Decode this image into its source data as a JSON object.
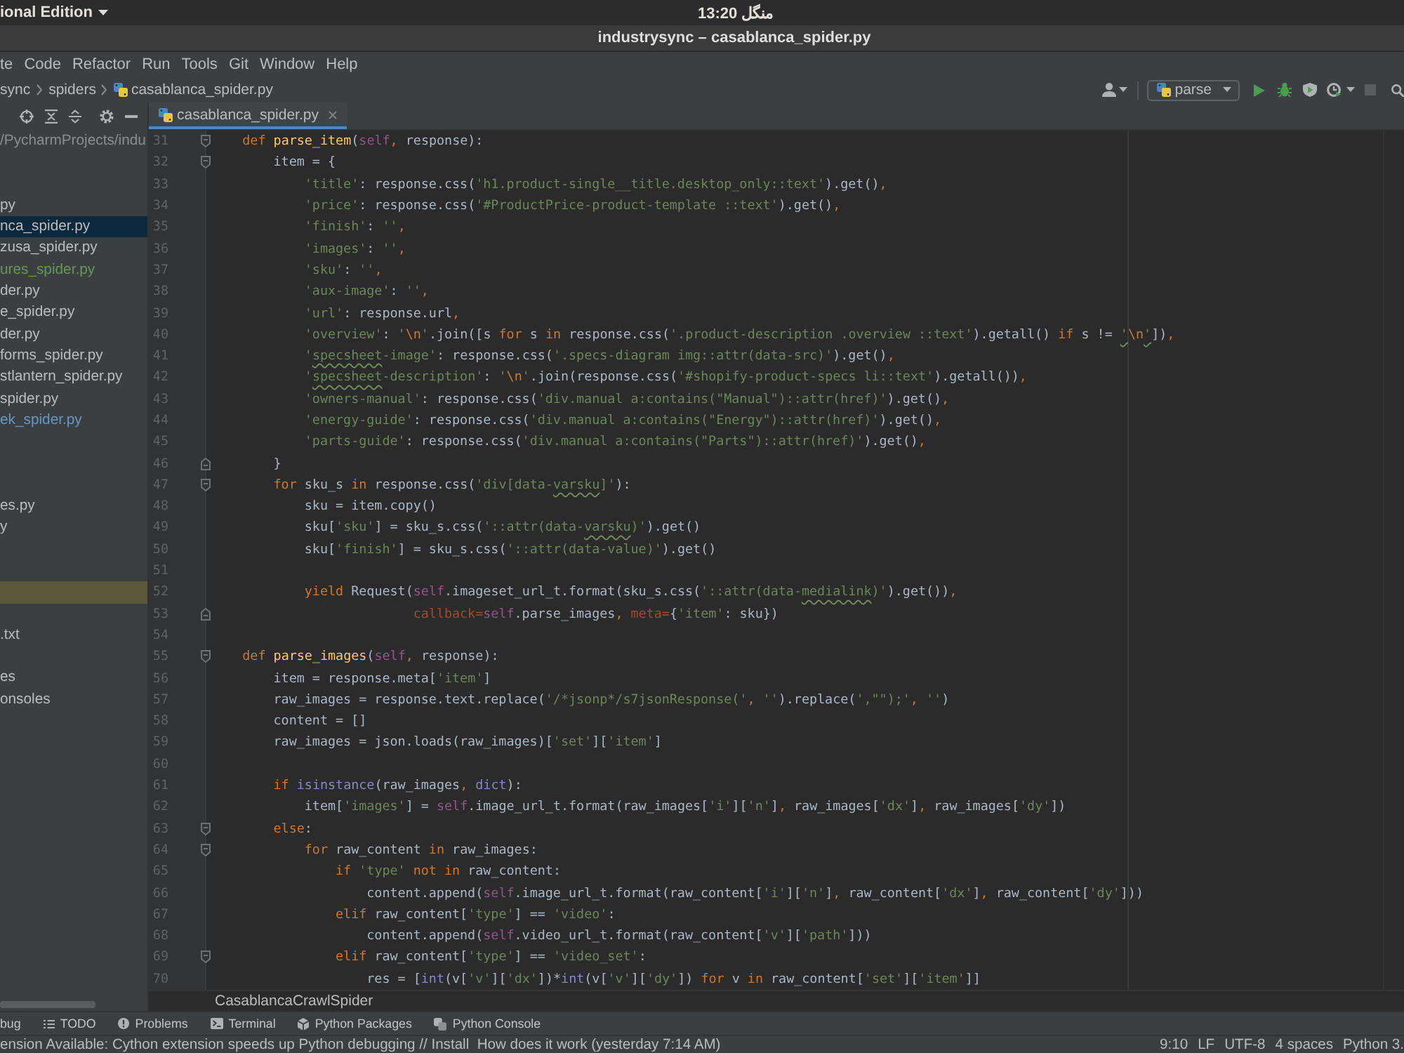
{
  "top_bar": {
    "app_menu": "ional Edition",
    "clock": "13:20 منگل"
  },
  "window": {
    "title": "industrysync – casablanca_spider.py"
  },
  "menu": [
    "te",
    "Code",
    "Refactor",
    "Run",
    "Tools",
    "Git",
    "Window",
    "Help"
  ],
  "navigation": {
    "path": [
      {
        "label": "sync",
        "kind": "folder"
      },
      {
        "label": "spiders",
        "kind": "folder"
      },
      {
        "label": "casablanca_spider.py",
        "kind": "file"
      }
    ],
    "run_config": "parse"
  },
  "project_tree": {
    "rows": [
      {
        "label": "/PycharmProjects/indu",
        "color": "#8c8c8c",
        "selected": false,
        "highlighted": false
      },
      {
        "selected": false,
        "highlighted": false
      },
      {
        "selected": false,
        "highlighted": false
      },
      {
        "label": "py",
        "color": "#bbbbbb",
        "selected": false,
        "highlighted": false
      },
      {
        "label": "nca_spider.py",
        "color": "#bbbbbb",
        "selected": true,
        "highlighted": false
      },
      {
        "label": "zusa_spider.py",
        "color": "#bbbbbb",
        "selected": false,
        "highlighted": false
      },
      {
        "label": "ures_spider.py",
        "color": "#629755",
        "selected": false,
        "highlighted": false
      },
      {
        "label": "der.py",
        "color": "#bbbbbb",
        "selected": false,
        "highlighted": false
      },
      {
        "label": "e_spider.py",
        "color": "#bbbbbb",
        "selected": false,
        "highlighted": false
      },
      {
        "label": "der.py",
        "color": "#bbbbbb",
        "selected": false,
        "highlighted": false
      },
      {
        "label": "forms_spider.py",
        "color": "#bbbbbb",
        "selected": false,
        "highlighted": false
      },
      {
        "label": "stlantern_spider.py",
        "color": "#bbbbbb",
        "selected": false,
        "highlighted": false
      },
      {
        "label": "spider.py",
        "color": "#bbbbbb",
        "selected": false,
        "highlighted": false
      },
      {
        "label": "ek_spider.py",
        "color": "#6897bb",
        "selected": false,
        "highlighted": false
      },
      {
        "selected": false,
        "highlighted": false
      },
      {
        "selected": false,
        "highlighted": false
      },
      {
        "selected": false,
        "highlighted": false
      },
      {
        "label": "es.py",
        "color": "#bbbbbb",
        "selected": false,
        "highlighted": false
      },
      {
        "label": "y",
        "color": "#bbbbbb",
        "selected": false,
        "highlighted": false
      },
      {
        "selected": false,
        "highlighted": false
      },
      {
        "selected": false,
        "highlighted": false
      },
      {
        "selected": false,
        "highlighted": true
      },
      {
        "selected": false,
        "highlighted": false
      },
      {
        "label": ".txt",
        "color": "#bbbbbb",
        "selected": false,
        "highlighted": false
      },
      {
        "selected": false,
        "highlighted": false
      },
      {
        "label": "es",
        "color": "#bbbbbb",
        "selected": false,
        "highlighted": false
      },
      {
        "label": "onsoles",
        "color": "#bbbbbb",
        "selected": false,
        "highlighted": false
      }
    ]
  },
  "tabs": [
    {
      "label": "casablanca_spider.py",
      "selected": true
    }
  ],
  "editor": {
    "lines": [
      {
        "number": "31",
        "kind": "opener",
        "tokens": [
          {
            "text": "    def ",
            "kind": "kw"
          },
          {
            "text": "parse_item",
            "kind": "fn"
          },
          {
            "text": "(",
            "kind": "plain"
          },
          {
            "text": "self",
            "kind": "self"
          },
          {
            "text": ",",
            "kind": "punct"
          },
          {
            "text": " response):",
            "kind": "plain"
          }
        ]
      },
      {
        "number": "32",
        "kind": "opener",
        "tokens": [
          {
            "text": "        item = {",
            "kind": "plain"
          }
        ]
      },
      {
        "number": "33",
        "kind": "line",
        "tokens": [
          {
            "text": "            'title'",
            "kind": "str"
          },
          {
            "text": ": response.css(",
            "kind": "plain"
          },
          {
            "text": "'h1.product-single__title.desktop_only::text'",
            "kind": "str"
          },
          {
            "text": ").get()",
            "kind": "plain"
          },
          {
            "text": ",",
            "kind": "punct"
          }
        ]
      },
      {
        "number": "34",
        "kind": "line",
        "tokens": [
          {
            "text": "            'price'",
            "kind": "str"
          },
          {
            "text": ": response.css(",
            "kind": "plain"
          },
          {
            "text": "'#ProductPrice-product-template ::text'",
            "kind": "str"
          },
          {
            "text": ").get()",
            "kind": "plain"
          },
          {
            "text": ",",
            "kind": "punct"
          }
        ]
      },
      {
        "number": "35",
        "kind": "line",
        "tokens": [
          {
            "text": "            'finish'",
            "kind": "str"
          },
          {
            "text": ": ",
            "kind": "plain"
          },
          {
            "text": "''",
            "kind": "str"
          },
          {
            "text": ",",
            "kind": "punct"
          }
        ]
      },
      {
        "number": "36",
        "kind": "line",
        "tokens": [
          {
            "text": "            'images'",
            "kind": "str"
          },
          {
            "text": ": ",
            "kind": "plain"
          },
          {
            "text": "''",
            "kind": "str"
          },
          {
            "text": ",",
            "kind": "punct"
          }
        ]
      },
      {
        "number": "37",
        "kind": "line",
        "tokens": [
          {
            "text": "            'sku'",
            "kind": "str"
          },
          {
            "text": ": ",
            "kind": "plain"
          },
          {
            "text": "''",
            "kind": "str"
          },
          {
            "text": ",",
            "kind": "punct"
          }
        ]
      },
      {
        "number": "38",
        "kind": "line",
        "tokens": [
          {
            "text": "            'aux-image'",
            "kind": "str"
          },
          {
            "text": ": ",
            "kind": "plain"
          },
          {
            "text": "''",
            "kind": "str"
          },
          {
            "text": ",",
            "kind": "punct"
          }
        ]
      },
      {
        "number": "39",
        "kind": "line",
        "tokens": [
          {
            "text": "            'url'",
            "kind": "str"
          },
          {
            "text": ": response.url",
            "kind": "plain"
          },
          {
            "text": ",",
            "kind": "punct"
          }
        ]
      },
      {
        "number": "40",
        "kind": "line",
        "tokens": [
          {
            "text": "            'overview'",
            "kind": "str"
          },
          {
            "text": ": ",
            "kind": "plain"
          },
          {
            "text": "'",
            "kind": "str"
          },
          {
            "text": "\\n",
            "kind": "esc"
          },
          {
            "text": "'",
            "kind": "str"
          },
          {
            "text": ".join([s ",
            "kind": "plain"
          },
          {
            "text": "for",
            "kind": "kw"
          },
          {
            "text": " s ",
            "kind": "plain"
          },
          {
            "text": "in",
            "kind": "kw"
          },
          {
            "text": " response.css(",
            "kind": "plain"
          },
          {
            "text": "'.product-description .overview ::text'",
            "kind": "str"
          },
          {
            "text": ").getall() ",
            "kind": "plain"
          },
          {
            "text": "if",
            "kind": "kw"
          },
          {
            "text": " s != ",
            "kind": "plain"
          },
          {
            "text": "'",
            "kind": "typo"
          },
          {
            "text": "\\n",
            "kind": "esc"
          },
          {
            "text": "'",
            "kind": "typo"
          },
          {
            "text": "])",
            "kind": "plain"
          },
          {
            "text": ",",
            "kind": "punct"
          }
        ]
      },
      {
        "number": "41",
        "kind": "line",
        "tokens": [
          {
            "text": "            '",
            "kind": "str"
          },
          {
            "text": "specsheet",
            "kind": "typo"
          },
          {
            "text": "-image'",
            "kind": "str"
          },
          {
            "text": ": response.css(",
            "kind": "plain"
          },
          {
            "text": "'.specs-diagram img::attr(data-src)'",
            "kind": "str"
          },
          {
            "text": ").get()",
            "kind": "plain"
          },
          {
            "text": ",",
            "kind": "punct"
          }
        ]
      },
      {
        "number": "42",
        "kind": "line",
        "tokens": [
          {
            "text": "            '",
            "kind": "str"
          },
          {
            "text": "specsheet",
            "kind": "typo"
          },
          {
            "text": "-description'",
            "kind": "str"
          },
          {
            "text": ": ",
            "kind": "plain"
          },
          {
            "text": "'",
            "kind": "str"
          },
          {
            "text": "\\n",
            "kind": "esc"
          },
          {
            "text": "'",
            "kind": "str"
          },
          {
            "text": ".join(response.css(",
            "kind": "plain"
          },
          {
            "text": "'#shopify-product-specs li::text'",
            "kind": "str"
          },
          {
            "text": ").getall())",
            "kind": "plain"
          },
          {
            "text": ",",
            "kind": "punct"
          }
        ]
      },
      {
        "number": "43",
        "kind": "line",
        "tokens": [
          {
            "text": "            'owners-manual'",
            "kind": "str"
          },
          {
            "text": ": response.css(",
            "kind": "plain"
          },
          {
            "text": "'div.manual a:contains(\"Manual\")::attr(href)'",
            "kind": "str"
          },
          {
            "text": ").get()",
            "kind": "plain"
          },
          {
            "text": ",",
            "kind": "punct"
          }
        ]
      },
      {
        "number": "44",
        "kind": "line",
        "tokens": [
          {
            "text": "            'energy-guide'",
            "kind": "str"
          },
          {
            "text": ": response.css(",
            "kind": "plain"
          },
          {
            "text": "'div.manual a:contains(\"Energy\")::attr(href)'",
            "kind": "str"
          },
          {
            "text": ").get()",
            "kind": "plain"
          },
          {
            "text": ",",
            "kind": "punct"
          }
        ]
      },
      {
        "number": "45",
        "kind": "line",
        "tokens": [
          {
            "text": "            'parts-guide'",
            "kind": "str"
          },
          {
            "text": ": response.css(",
            "kind": "plain"
          },
          {
            "text": "'div.manual a:contains(\"Parts\")::attr(href)'",
            "kind": "str"
          },
          {
            "text": ").get()",
            "kind": "plain"
          },
          {
            "text": ",",
            "kind": "punct"
          }
        ]
      },
      {
        "number": "46",
        "kind": "closer",
        "tokens": [
          {
            "text": "        }",
            "kind": "plain"
          }
        ]
      },
      {
        "number": "47",
        "kind": "opener",
        "tokens": [
          {
            "text": "        for",
            "kind": "kw"
          },
          {
            "text": " sku_s ",
            "kind": "plain"
          },
          {
            "text": "in",
            "kind": "kw"
          },
          {
            "text": " response.css(",
            "kind": "plain"
          },
          {
            "text": "'div[data-",
            "kind": "str"
          },
          {
            "text": "varsku",
            "kind": "typo"
          },
          {
            "text": "]'",
            "kind": "str"
          },
          {
            "text": "):",
            "kind": "plain"
          }
        ]
      },
      {
        "number": "48",
        "kind": "line",
        "tokens": [
          {
            "text": "            sku = item.copy()",
            "kind": "plain"
          }
        ]
      },
      {
        "number": "49",
        "kind": "line",
        "tokens": [
          {
            "text": "            sku[",
            "kind": "plain"
          },
          {
            "text": "'sku'",
            "kind": "str"
          },
          {
            "text": "] = sku_s.css(",
            "kind": "plain"
          },
          {
            "text": "'::attr(data-",
            "kind": "str"
          },
          {
            "text": "varsku",
            "kind": "typo"
          },
          {
            "text": ")'",
            "kind": "str"
          },
          {
            "text": ").get()",
            "kind": "plain"
          }
        ]
      },
      {
        "number": "50",
        "kind": "line",
        "tokens": [
          {
            "text": "            sku[",
            "kind": "plain"
          },
          {
            "text": "'finish'",
            "kind": "str"
          },
          {
            "text": "] = sku_s.css(",
            "kind": "plain"
          },
          {
            "text": "'::attr(data-value)'",
            "kind": "str"
          },
          {
            "text": ").get()",
            "kind": "plain"
          }
        ]
      },
      {
        "number": "51",
        "kind": "line"
      },
      {
        "number": "52",
        "kind": "line",
        "tokens": [
          {
            "text": "            yield",
            "kind": "kw"
          },
          {
            "text": " Request(",
            "kind": "plain"
          },
          {
            "text": "self",
            "kind": "self"
          },
          {
            "text": ".imageset_url_t.format(sku_s.css(",
            "kind": "plain"
          },
          {
            "text": "'::attr(data-",
            "kind": "str"
          },
          {
            "text": "medialink",
            "kind": "typo"
          },
          {
            "text": ")'",
            "kind": "str"
          },
          {
            "text": ").get())",
            "kind": "plain"
          },
          {
            "text": ",",
            "kind": "punct"
          }
        ]
      },
      {
        "number": "53",
        "kind": "closer",
        "tokens": [
          {
            "text": "                          callback=",
            "kind": "arg"
          },
          {
            "text": "self",
            "kind": "self"
          },
          {
            "text": ".parse_images",
            "kind": "plain"
          },
          {
            "text": ", ",
            "kind": "punct"
          },
          {
            "text": "meta=",
            "kind": "arg"
          },
          {
            "text": "{",
            "kind": "plain"
          },
          {
            "text": "'item'",
            "kind": "str"
          },
          {
            "text": ": sku})",
            "kind": "plain"
          }
        ]
      },
      {
        "number": "54",
        "kind": "line"
      },
      {
        "number": "55",
        "kind": "opener",
        "tokens": [
          {
            "text": "    def ",
            "kind": "kw"
          },
          {
            "text": "parse_images",
            "kind": "fn"
          },
          {
            "text": "(",
            "kind": "plain"
          },
          {
            "text": "self",
            "kind": "self"
          },
          {
            "text": ",",
            "kind": "punct"
          },
          {
            "text": " response):",
            "kind": "plain"
          }
        ]
      },
      {
        "number": "56",
        "kind": "line",
        "tokens": [
          {
            "text": "        item = response.meta[",
            "kind": "plain"
          },
          {
            "text": "'item'",
            "kind": "str"
          },
          {
            "text": "]",
            "kind": "plain"
          }
        ]
      },
      {
        "number": "57",
        "kind": "line",
        "tokens": [
          {
            "text": "        raw_images = response.text.replace(",
            "kind": "plain"
          },
          {
            "text": "'/*jsonp*/s7jsonResponse('",
            "kind": "str"
          },
          {
            "text": ", ",
            "kind": "punct"
          },
          {
            "text": "''",
            "kind": "str"
          },
          {
            "text": ").replace(",
            "kind": "plain"
          },
          {
            "text": "',\"\");'",
            "kind": "str"
          },
          {
            "text": ", ",
            "kind": "punct"
          },
          {
            "text": "''",
            "kind": "str"
          },
          {
            "text": ")",
            "kind": "plain"
          }
        ]
      },
      {
        "number": "58",
        "kind": "line",
        "tokens": [
          {
            "text": "        content = []",
            "kind": "plain"
          }
        ]
      },
      {
        "number": "59",
        "kind": "line",
        "tokens": [
          {
            "text": "        raw_images = json.loads(raw_images)[",
            "kind": "plain"
          },
          {
            "text": "'set'",
            "kind": "str"
          },
          {
            "text": "][",
            "kind": "plain"
          },
          {
            "text": "'item'",
            "kind": "str"
          },
          {
            "text": "]",
            "kind": "plain"
          }
        ]
      },
      {
        "number": "60",
        "kind": "line"
      },
      {
        "number": "61",
        "kind": "line",
        "tokens": [
          {
            "text": "        if ",
            "kind": "kw"
          },
          {
            "text": "isinstance",
            "kind": "builtin"
          },
          {
            "text": "(raw_images",
            "kind": "plain"
          },
          {
            "text": ", ",
            "kind": "punct"
          },
          {
            "text": "dict",
            "kind": "builtin"
          },
          {
            "text": "):",
            "kind": "plain"
          }
        ]
      },
      {
        "number": "62",
        "kind": "line",
        "tokens": [
          {
            "text": "            item[",
            "kind": "plain"
          },
          {
            "text": "'images'",
            "kind": "str"
          },
          {
            "text": "] = ",
            "kind": "plain"
          },
          {
            "text": "self",
            "kind": "self"
          },
          {
            "text": ".image_url_t.format(raw_images[",
            "kind": "plain"
          },
          {
            "text": "'i'",
            "kind": "str"
          },
          {
            "text": "][",
            "kind": "plain"
          },
          {
            "text": "'n'",
            "kind": "str"
          },
          {
            "text": "]",
            "kind": "plain"
          },
          {
            "text": ", ",
            "kind": "punct"
          },
          {
            "text": "raw_images[",
            "kind": "plain"
          },
          {
            "text": "'dx'",
            "kind": "str"
          },
          {
            "text": "]",
            "kind": "plain"
          },
          {
            "text": ", ",
            "kind": "punct"
          },
          {
            "text": "raw_images[",
            "kind": "plain"
          },
          {
            "text": "'dy'",
            "kind": "str"
          },
          {
            "text": "])",
            "kind": "plain"
          }
        ]
      },
      {
        "number": "63",
        "kind": "opener",
        "tokens": [
          {
            "text": "        else",
            "kind": "kw"
          },
          {
            "text": ":",
            "kind": "plain"
          }
        ]
      },
      {
        "number": "64",
        "kind": "opener",
        "tokens": [
          {
            "text": "            for",
            "kind": "kw"
          },
          {
            "text": " raw_content ",
            "kind": "plain"
          },
          {
            "text": "in",
            "kind": "kw"
          },
          {
            "text": " raw_images:",
            "kind": "plain"
          }
        ]
      },
      {
        "number": "65",
        "kind": "line",
        "tokens": [
          {
            "text": "                if ",
            "kind": "kw"
          },
          {
            "text": "'type'",
            "kind": "str"
          },
          {
            "text": " not in ",
            "kind": "kw"
          },
          {
            "text": "raw_content:",
            "kind": "plain"
          }
        ]
      },
      {
        "number": "66",
        "kind": "line",
        "tokens": [
          {
            "text": "                    content.append(",
            "kind": "plain"
          },
          {
            "text": "self",
            "kind": "self"
          },
          {
            "text": ".image_url_t.format(raw_content[",
            "kind": "plain"
          },
          {
            "text": "'i'",
            "kind": "str"
          },
          {
            "text": "][",
            "kind": "plain"
          },
          {
            "text": "'n'",
            "kind": "str"
          },
          {
            "text": "]",
            "kind": "plain"
          },
          {
            "text": ", ",
            "kind": "punct"
          },
          {
            "text": "raw_content[",
            "kind": "plain"
          },
          {
            "text": "'dx'",
            "kind": "str"
          },
          {
            "text": "]",
            "kind": "plain"
          },
          {
            "text": ", ",
            "kind": "punct"
          },
          {
            "text": "raw_content[",
            "kind": "plain"
          },
          {
            "text": "'dy'",
            "kind": "str"
          },
          {
            "text": "]))",
            "kind": "plain"
          }
        ]
      },
      {
        "number": "67",
        "kind": "line",
        "tokens": [
          {
            "text": "                elif",
            "kind": "kw"
          },
          {
            "text": " raw_content[",
            "kind": "plain"
          },
          {
            "text": "'type'",
            "kind": "str"
          },
          {
            "text": "] == ",
            "kind": "plain"
          },
          {
            "text": "'video'",
            "kind": "str"
          },
          {
            "text": ":",
            "kind": "plain"
          }
        ]
      },
      {
        "number": "68",
        "kind": "line",
        "tokens": [
          {
            "text": "                    content.append(",
            "kind": "plain"
          },
          {
            "text": "self",
            "kind": "self"
          },
          {
            "text": ".video_url_t.format(raw_content[",
            "kind": "plain"
          },
          {
            "text": "'v'",
            "kind": "str"
          },
          {
            "text": "][",
            "kind": "plain"
          },
          {
            "text": "'path'",
            "kind": "str"
          },
          {
            "text": "]))",
            "kind": "plain"
          }
        ]
      },
      {
        "number": "69",
        "kind": "opener",
        "tokens": [
          {
            "text": "                elif",
            "kind": "kw"
          },
          {
            "text": " raw_content[",
            "kind": "plain"
          },
          {
            "text": "'type'",
            "kind": "str"
          },
          {
            "text": "] == ",
            "kind": "plain"
          },
          {
            "text": "'video_set'",
            "kind": "str"
          },
          {
            "text": ":",
            "kind": "plain"
          }
        ]
      },
      {
        "number": "70",
        "kind": "line",
        "tokens": [
          {
            "text": "                    res = [",
            "kind": "plain"
          },
          {
            "text": "int",
            "kind": "builtin"
          },
          {
            "text": "(v[",
            "kind": "plain"
          },
          {
            "text": "'v'",
            "kind": "str"
          },
          {
            "text": "][",
            "kind": "plain"
          },
          {
            "text": "'dx'",
            "kind": "str"
          },
          {
            "text": "])*",
            "kind": "plain"
          },
          {
            "text": "int",
            "kind": "builtin"
          },
          {
            "text": "(v[",
            "kind": "plain"
          },
          {
            "text": "'v'",
            "kind": "str"
          },
          {
            "text": "][",
            "kind": "plain"
          },
          {
            "text": "'dy'",
            "kind": "str"
          },
          {
            "text": "]) ",
            "kind": "plain"
          },
          {
            "text": "for",
            "kind": "kw"
          },
          {
            "text": " v ",
            "kind": "plain"
          },
          {
            "text": "in",
            "kind": "kw"
          },
          {
            "text": " raw_content[",
            "kind": "plain"
          },
          {
            "text": "'set'",
            "kind": "str"
          },
          {
            "text": "][",
            "kind": "plain"
          },
          {
            "text": "'item'",
            "kind": "str"
          },
          {
            "text": "]]",
            "kind": "plain"
          }
        ]
      }
    ]
  },
  "breadcrumb": "CasablancaCrawlSpider",
  "tool_windows": [
    {
      "label": "bug",
      "kind": "debug"
    },
    {
      "label": "TODO",
      "kind": "todo"
    },
    {
      "label": "Problems",
      "kind": "problems"
    },
    {
      "label": "Terminal",
      "kind": "terminal"
    },
    {
      "label": "Python Packages",
      "kind": "packages"
    },
    {
      "label": "Python Console",
      "kind": "console"
    }
  ],
  "status_bar": {
    "message": "ension Available: Cython extension speeds up Python debugging // Install  How does it work (yesterday 7:14 AM)",
    "items": [
      "9:10",
      "LF",
      "UTF-8",
      "4 spaces",
      "Python 3."
    ]
  }
}
